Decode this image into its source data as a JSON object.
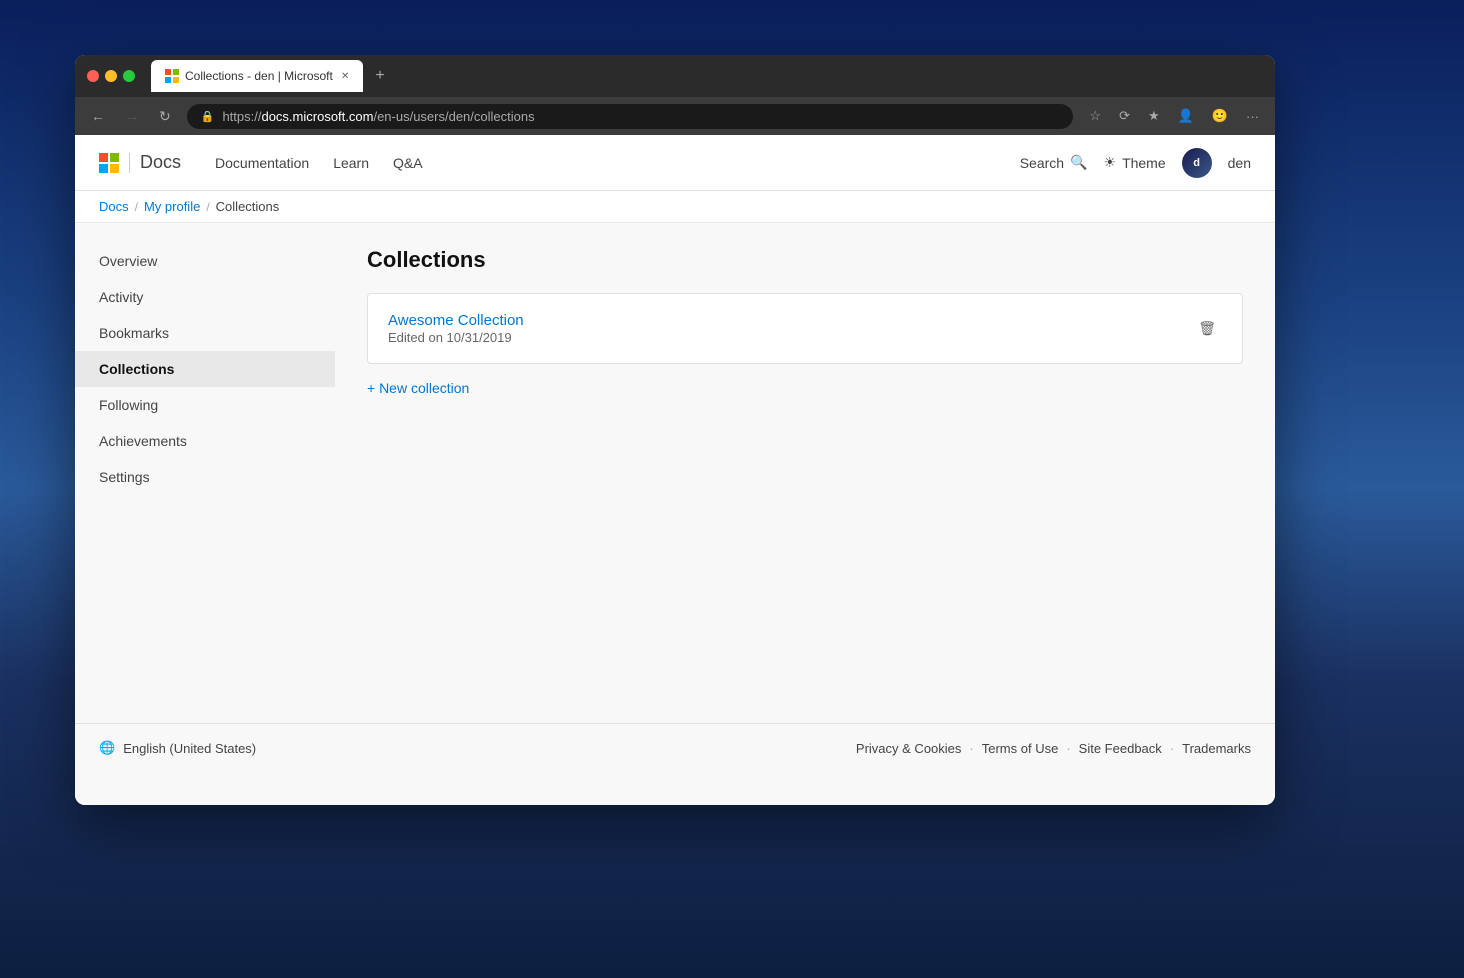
{
  "background": "#1a3a6b",
  "browser": {
    "tab_title": "Collections - den | Microsoft Do",
    "tab_favicon": "M",
    "url": "https://docs.microsoft.com/en-us/users/den/collections",
    "url_protocol": "https://",
    "url_domain": "docs.microsoft.com",
    "url_path": "/en-us/users/den/collections"
  },
  "header": {
    "brand": "Microsoft",
    "docs_label": "Docs",
    "nav_items": [
      {
        "label": "Documentation",
        "key": "documentation"
      },
      {
        "label": "Learn",
        "key": "learn"
      },
      {
        "label": "Q&A",
        "key": "qa"
      }
    ],
    "search_label": "Search",
    "theme_label": "Theme",
    "user_name": "den",
    "user_initials": "d"
  },
  "breadcrumb": {
    "items": [
      {
        "label": "Docs",
        "key": "docs"
      },
      {
        "label": "My profile",
        "key": "my-profile"
      },
      {
        "label": "Collections",
        "key": "collections"
      }
    ]
  },
  "sidebar": {
    "items": [
      {
        "label": "Overview",
        "key": "overview",
        "active": false
      },
      {
        "label": "Activity",
        "key": "activity",
        "active": false
      },
      {
        "label": "Bookmarks",
        "key": "bookmarks",
        "active": false
      },
      {
        "label": "Collections",
        "key": "collections",
        "active": true
      },
      {
        "label": "Following",
        "key": "following",
        "active": false
      },
      {
        "label": "Achievements",
        "key": "achievements",
        "active": false
      },
      {
        "label": "Settings",
        "key": "settings",
        "active": false
      }
    ]
  },
  "content": {
    "title": "Collections",
    "collections": [
      {
        "name": "Awesome Collection",
        "meta": "Edited on 10/31/2019"
      }
    ],
    "new_collection_label": "+ New collection"
  },
  "footer": {
    "locale": "English (United States)",
    "links": [
      {
        "label": "Privacy & Cookies",
        "key": "privacy"
      },
      {
        "label": "Terms of Use",
        "key": "terms"
      },
      {
        "label": "Site Feedback",
        "key": "feedback"
      },
      {
        "label": "Trademarks",
        "key": "trademarks"
      }
    ]
  }
}
